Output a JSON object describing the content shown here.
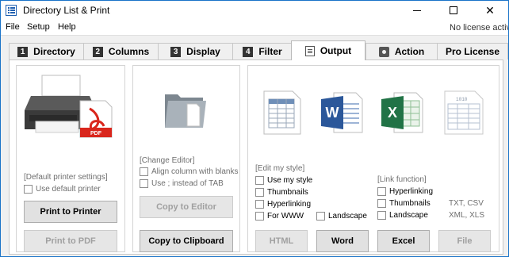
{
  "window": {
    "title": "Directory List & Print",
    "license_status": "No license active"
  },
  "menu": {
    "file": "File",
    "setup": "Setup",
    "help": "Help"
  },
  "tabs": [
    {
      "num": "1",
      "label": "Directory"
    },
    {
      "num": "2",
      "label": "Columns"
    },
    {
      "num": "3",
      "label": "Display"
    },
    {
      "num": "4",
      "label": "Filter"
    },
    {
      "num": "",
      "label": "Output"
    },
    {
      "num": "",
      "label": "Action"
    },
    {
      "num": "",
      "label": "Pro License"
    }
  ],
  "active_tab": "Output",
  "printer_panel": {
    "section_label": "[Default printer settings]",
    "use_default_printer": "Use default printer",
    "print_to_printer": "Print to Printer",
    "print_to_pdf": "Print to PDF",
    "pdf_badge": "PDF"
  },
  "editor_panel": {
    "section_label": "[Change Editor]",
    "align_columns": "Align column with blanks",
    "use_semicolon": "Use  ;  instead of TAB",
    "copy_to_editor": "Copy to Editor",
    "copy_to_clipboard": "Copy to Clipboard"
  },
  "export_panel": {
    "style_label": "[Edit my style]",
    "use_my_style": "Use my style",
    "thumbnails": "Thumbnails",
    "hyperlinking": "Hyperlinking",
    "for_www": "For WWW",
    "landscape": "Landscape",
    "link_label": "[Link function]",
    "link_hyperlinking": "Hyperlinking",
    "link_thumbnails": "Thumbnails",
    "link_landscape": "Landscape",
    "txt_csv": "TXT, CSV",
    "xml_xls": "XML, XLS",
    "html_button": "HTML",
    "word_button": "Word",
    "excel_button": "Excel",
    "file_button": "File",
    "word_letter": "W",
    "excel_letter": "X",
    "file_digits": "1010"
  },
  "colors": {
    "title_accent": "#1f5fb0",
    "pdf_red": "#d9261c",
    "word_blue": "#2b579a",
    "excel_green": "#217346",
    "disabled_text": "#a0a0a0"
  }
}
